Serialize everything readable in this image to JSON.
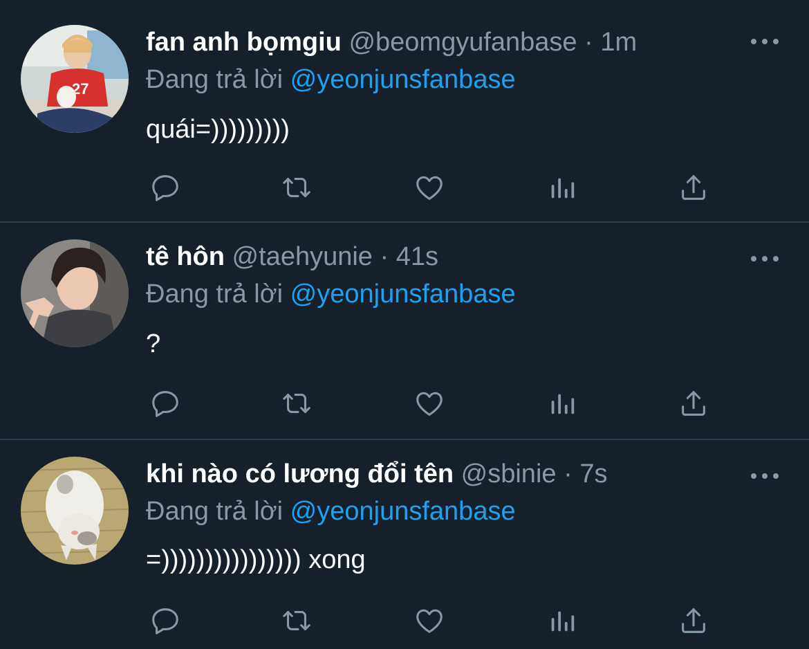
{
  "tweets": [
    {
      "name": "fan anh bọmgiu",
      "handle": "@beomgyufanbase",
      "separator": "·",
      "time": "1m",
      "reply_prefix": "Đang trả lời",
      "reply_to": "@yeonjunsfanbase",
      "text": "quái=)))))))))",
      "avatar": "person-red-shirt-avatar"
    },
    {
      "name": "tê hôn",
      "handle": "@taehyunie",
      "separator": "·",
      "time": "41s",
      "reply_prefix": "Đang trả lời",
      "reply_to": "@yeonjunsfanbase",
      "text": "?",
      "avatar": "person-dark-hair-avatar"
    },
    {
      "name": "khi nào có lương đổi tên",
      "handle": "@sbinie",
      "separator": "·",
      "time": "7s",
      "reply_prefix": "Đang trả lời",
      "reply_to": "@yeonjunsfanbase",
      "text": "=)))))))))))))))) xong",
      "avatar": "cat-avatar"
    }
  ],
  "actions": [
    "reply-icon",
    "retweet-icon",
    "like-icon",
    "stats-icon",
    "share-icon"
  ],
  "colors": {
    "background": "#15202b",
    "divider": "#2f3d4a",
    "secondary_text": "#8899a6",
    "mention": "#1da1f2",
    "primary_text": "#ffffff"
  }
}
